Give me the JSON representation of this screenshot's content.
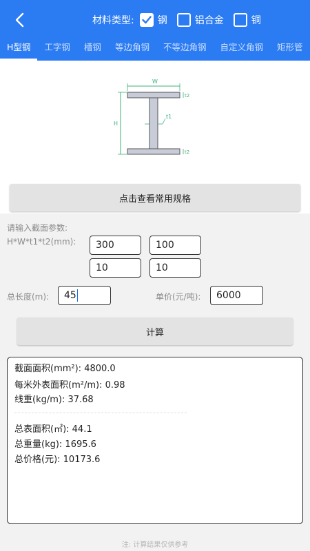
{
  "header": {
    "material_label": "材料类型:",
    "materials": [
      {
        "label": "钢",
        "checked": true
      },
      {
        "label": "铝合金",
        "checked": false
      },
      {
        "label": "铜",
        "checked": false
      }
    ],
    "tabs": [
      "H型钢",
      "工字钢",
      "槽钢",
      "等边角钢",
      "不等边角钢",
      "自定义角钢",
      "矩形管"
    ],
    "active_tab": 0
  },
  "diagram": {
    "w": "W",
    "h": "H",
    "t1": "t1",
    "t2_top": "t2",
    "t2_bottom": "t2"
  },
  "spec_button": "点击查看常用规格",
  "params": {
    "prompt": "请输入截面参数:",
    "formula": "H*W*t1*t2(mm):",
    "h": "300",
    "w": "100",
    "t1": "10",
    "t2": "10",
    "length_label": "总长度(m):",
    "length": "45",
    "price_label": "单价(元/吨):",
    "price": "6000"
  },
  "calc_button": "计算",
  "results": {
    "area": "截面面积(mm²): 4800.0",
    "surface_per_m": "每米外表面积(m²/m): 0.98",
    "line_weight": "线重(kg/m): 37.68",
    "total_surface": "总表面积(㎡): 44.1",
    "total_weight": "总重量(kg): 1695.6",
    "total_price": "总价格(元): 10173.6"
  },
  "note": "注: 计算结果仅供参考"
}
